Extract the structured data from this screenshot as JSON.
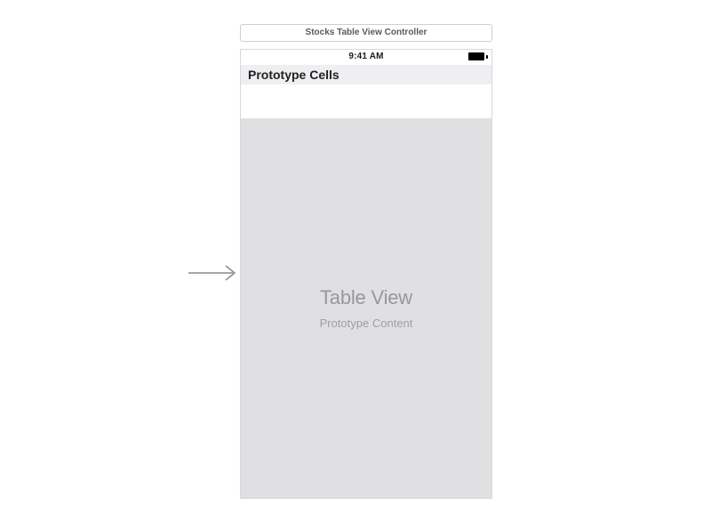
{
  "vc_title": "Stocks Table View Controller",
  "status_bar": {
    "time": "9:41 AM"
  },
  "prototype_header": "Prototype Cells",
  "placeholder": {
    "title": "Table View",
    "subtitle": "Prototype Content"
  }
}
